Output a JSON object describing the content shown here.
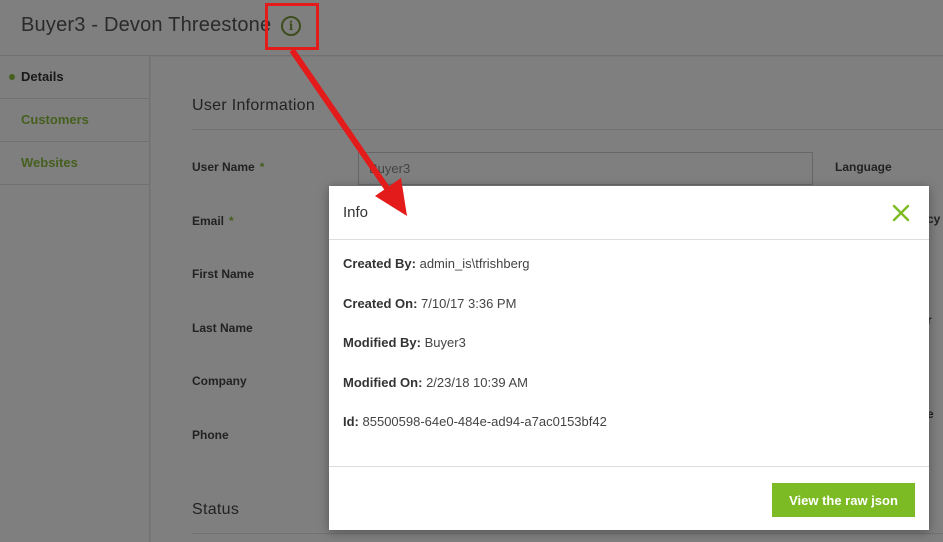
{
  "header": {
    "title": "Buyer3 - Devon Threestone",
    "info_icon_glyph": "i"
  },
  "sidebar": {
    "items": [
      {
        "label": "Details",
        "active": true
      },
      {
        "label": "Customers",
        "active": false
      },
      {
        "label": "Websites",
        "active": false
      }
    ]
  },
  "main": {
    "user_info_title": "User Information",
    "status_title": "Status",
    "fields": {
      "user_name": "User Name",
      "email": "Email",
      "first_name": "First Name",
      "last_name": "Last Name",
      "company": "Company",
      "phone": "Phone",
      "required_mark": "*"
    },
    "user_name_value": "Buyer3",
    "right_labels": {
      "language": "Language",
      "partial_1": "cy",
      "partial_2": "r",
      "partial_3": "e"
    }
  },
  "modal": {
    "title": "Info",
    "rows": [
      {
        "label": "Created By:",
        "value": "admin_is\\tfrishberg"
      },
      {
        "label": "Created On:",
        "value": "7/10/17 3:36 PM"
      },
      {
        "label": "Modified By:",
        "value": "Buyer3"
      },
      {
        "label": "Modified On:",
        "value": "2/23/18 10:39 AM"
      },
      {
        "label": "Id:",
        "value": "85500598-64e0-484e-ad94-a7ac0153bf42"
      }
    ],
    "view_raw_label": "View the raw json"
  },
  "colors": {
    "accent": "#7dbb25",
    "callout": "#e31b1b",
    "overlay": "rgba(0,0,0,0.5)"
  }
}
